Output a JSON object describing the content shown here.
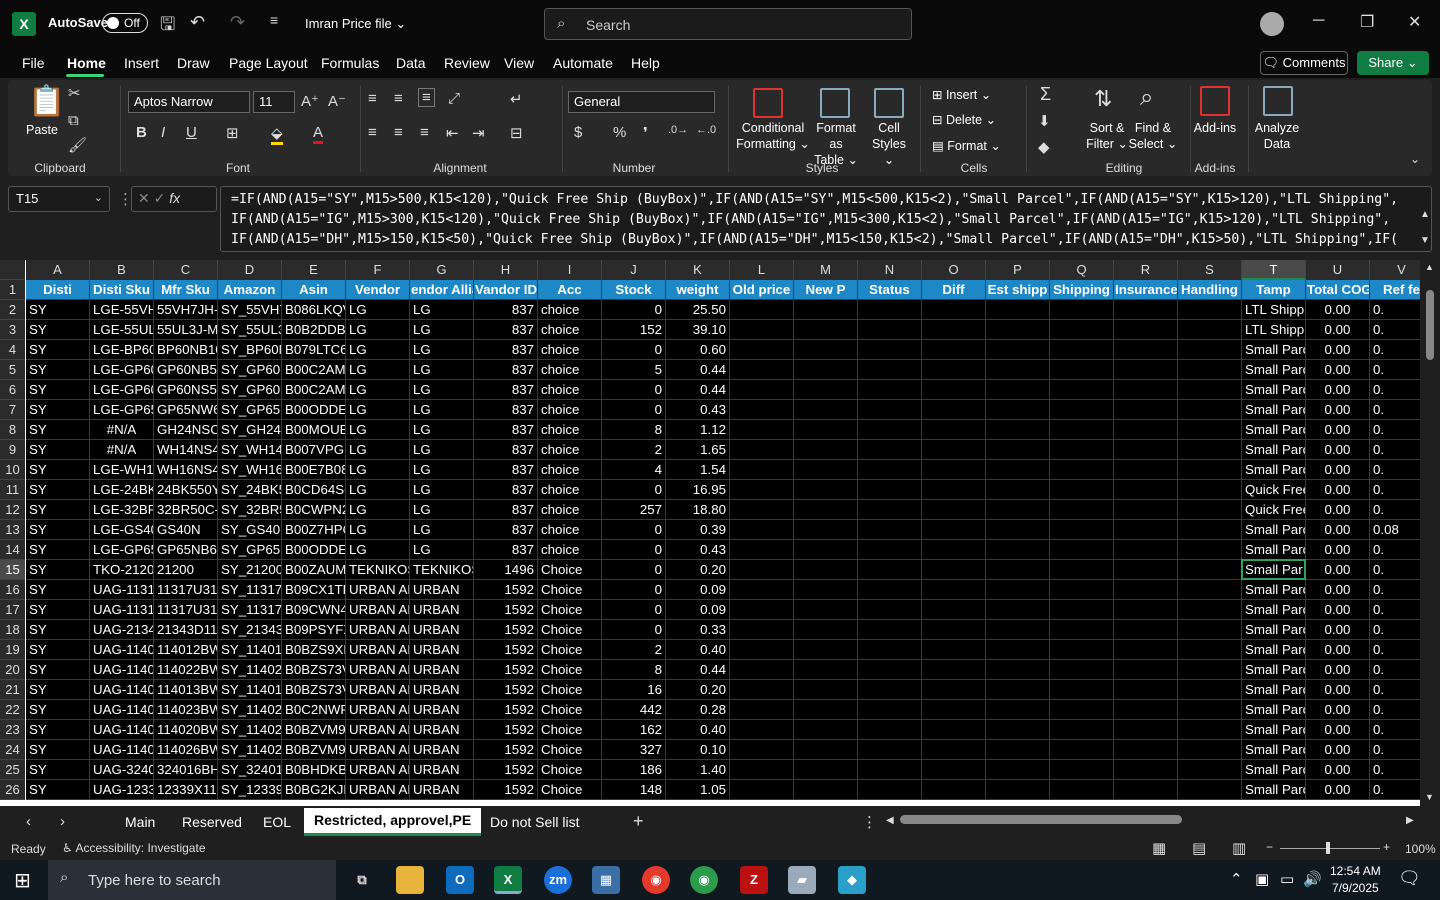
{
  "app": {
    "autosave_label": "AutoSave",
    "autosave_state": "Off",
    "filename": "Imran Price file",
    "search_placeholder": "Search"
  },
  "menu": {
    "items": [
      "File",
      "Home",
      "Insert",
      "Draw",
      "Page Layout",
      "Formulas",
      "Data",
      "Review",
      "View",
      "Automate",
      "Help"
    ],
    "active": "Home",
    "comments": "Comments",
    "share": "Share"
  },
  "ribbon": {
    "font_name": "Aptos Narrow",
    "font_size": "11",
    "number_format": "General",
    "paste": "Paste",
    "groups": [
      "Clipboard",
      "Font",
      "Alignment",
      "Number",
      "Styles",
      "Cells",
      "Editing",
      "Add-ins"
    ],
    "conditional_formatting": [
      "Conditional",
      "Formatting"
    ],
    "format_as_table": [
      "Format as",
      "Table"
    ],
    "cell_styles": [
      "Cell",
      "Styles"
    ],
    "insert": "Insert",
    "delete": "Delete",
    "format": "Format",
    "sort_filter": [
      "Sort &",
      "Filter"
    ],
    "find_select": [
      "Find &",
      "Select"
    ],
    "addins": "Add-ins",
    "analyze_data": [
      "Analyze",
      "Data"
    ]
  },
  "namebox": "T15",
  "formula_lines": [
    "=IF(AND(A15=\"SY\",M15>500,K15<120),\"Quick Free Ship (BuyBox)\",IF(AND(A15=\"SY\",M15<500,K15<2),\"Small Parcel\",IF(AND(A15=\"SY\",K15>120),\"LTL Shipping\",",
    "IF(AND(A15=\"IG\",M15>300,K15<120),\"Quick Free Ship (BuyBox)\",IF(AND(A15=\"IG\",M15<300,K15<2),\"Small Parcel\",IF(AND(A15=\"IG\",K15>120),\"LTL Shipping\",",
    "IF(AND(A15=\"DH\",M15>150,K15<50),\"Quick Free Ship (BuyBox)\",IF(AND(A15=\"DH\",M15<150,K15<2),\"Small Parcel\",IF(AND(A15=\"DH\",K15>50),\"LTL Shipping\",IF("
  ],
  "grid": {
    "columns": [
      "A",
      "B",
      "C",
      "D",
      "E",
      "F",
      "G",
      "H",
      "I",
      "J",
      "K",
      "L",
      "M",
      "N",
      "O",
      "P",
      "Q",
      "R",
      "S",
      "T",
      "U",
      "V"
    ],
    "headers": [
      "Disti",
      "Disti Sku",
      "Mfr Sku",
      "Amazon",
      "Asin",
      "Vendor",
      "endor Allia",
      "Vandor ID",
      "Acc",
      "Stock",
      "weight",
      "Old price",
      "New P",
      "Status",
      "Diff",
      "Est shipp",
      "Shipping",
      "Insurance",
      "Handling",
      "Tamp",
      "Total COG",
      "Ref fe"
    ],
    "selected_cell": "T15",
    "rows": [
      {
        "n": "2",
        "c": [
          "SY",
          "LGE-55VH7",
          "55VH7JH-4",
          "SY_55VH7J",
          "B086LKQV",
          "LG",
          "LG",
          "837",
          "choice",
          "0",
          "25.50",
          "",
          "",
          "",
          "",
          "",
          "",
          "",
          "",
          "LTL Shippi",
          "0.00",
          "0."
        ]
      },
      {
        "n": "3",
        "c": [
          "SY",
          "LGE-55UL3",
          "55UL3J-M",
          "SY_55UL3J",
          "B0B2DDBC",
          "LG",
          "LG",
          "837",
          "choice",
          "152",
          "39.10",
          "",
          "",
          "",
          "",
          "",
          "",
          "",
          "",
          "LTL Shippi",
          "0.00",
          "0."
        ]
      },
      {
        "n": "4",
        "c": [
          "SY",
          "LGE-BP60N",
          "BP60NB10",
          "SY_BP60N",
          "B079LTC6N",
          "LG",
          "LG",
          "837",
          "choice",
          "0",
          "0.60",
          "",
          "",
          "",
          "",
          "",
          "",
          "",
          "",
          "Small Parc",
          "0.00",
          "0."
        ]
      },
      {
        "n": "5",
        "c": [
          "SY",
          "LGE-GP60I",
          "GP60NB50",
          "SY_GP60N",
          "B00C2AMK",
          "LG",
          "LG",
          "837",
          "choice",
          "5",
          "0.44",
          "",
          "",
          "",
          "",
          "",
          "",
          "",
          "",
          "Small Parc",
          "0.00",
          "0."
        ]
      },
      {
        "n": "6",
        "c": [
          "SY",
          "LGE-GP60I",
          "GP60NS50",
          "SY_GP60N",
          "B00C2AMK",
          "LG",
          "LG",
          "837",
          "choice",
          "0",
          "0.44",
          "",
          "",
          "",
          "",
          "",
          "",
          "",
          "",
          "Small Parc",
          "0.00",
          "0."
        ]
      },
      {
        "n": "7",
        "c": [
          "SY",
          "LGE-GP65I",
          "GP65NW6",
          "SY_GP65N",
          "B00ODDEA",
          "LG",
          "LG",
          "837",
          "choice",
          "0",
          "0.43",
          "",
          "",
          "",
          "",
          "",
          "",
          "",
          "",
          "Small Parc",
          "0.00",
          "0."
        ]
      },
      {
        "n": "8",
        "c": [
          "SY",
          "#N/A",
          "GH24NSC0",
          "SY_GH24N",
          "B00MOUB",
          "LG",
          "LG",
          "837",
          "choice",
          "8",
          "1.12",
          "",
          "",
          "",
          "",
          "",
          "",
          "",
          "",
          "Small Parc",
          "0.00",
          "0."
        ]
      },
      {
        "n": "9",
        "c": [
          "SY",
          "#N/A",
          "WH14NS40",
          "SY_WH14N",
          "B007VPGL",
          "LG",
          "LG",
          "837",
          "choice",
          "2",
          "1.65",
          "",
          "",
          "",
          "",
          "",
          "",
          "",
          "",
          "Small Parc",
          "0.00",
          "0."
        ]
      },
      {
        "n": "10",
        "c": [
          "SY",
          "LGE-WH16",
          "WH16NS40",
          "SY_WH16N",
          "B00E7B08I",
          "LG",
          "LG",
          "837",
          "choice",
          "4",
          "1.54",
          "",
          "",
          "",
          "",
          "",
          "",
          "",
          "",
          "Small Parc",
          "0.00",
          "0."
        ]
      },
      {
        "n": "11",
        "c": [
          "SY",
          "LGE-24BK5",
          "24BK550Y-",
          "SY_24BK55",
          "B0CD64S6",
          "LG",
          "LG",
          "837",
          "choice",
          "0",
          "16.95",
          "",
          "",
          "",
          "",
          "",
          "",
          "",
          "",
          "Quick Free",
          "0.00",
          "0."
        ]
      },
      {
        "n": "12",
        "c": [
          "SY",
          "LGE-32BR5",
          "32BR50C-E",
          "SY_32BR50",
          "B0CWPN2",
          "LG",
          "LG",
          "837",
          "choice",
          "257",
          "18.80",
          "",
          "",
          "",
          "",
          "",
          "",
          "",
          "",
          "Quick Free",
          "0.00",
          "0."
        ]
      },
      {
        "n": "13",
        "c": [
          "SY",
          "LGE-GS40I",
          "GS40N",
          "SY_GS40N",
          "B00Z7HPQ",
          "LG",
          "LG",
          "837",
          "choice",
          "0",
          "0.39",
          "",
          "",
          "",
          "",
          "",
          "",
          "",
          "",
          "Small Parc",
          "0.00",
          "0.08"
        ]
      },
      {
        "n": "14",
        "c": [
          "SY",
          "LGE-GP65I",
          "GP65NB60",
          "SY_GP65N",
          "B00ODDE3",
          "LG",
          "LG",
          "837",
          "choice",
          "0",
          "0.43",
          "",
          "",
          "",
          "",
          "",
          "",
          "",
          "",
          "Small Parc",
          "0.00",
          "0."
        ]
      },
      {
        "n": "15",
        "c": [
          "SY",
          "TKO-21200",
          "21200",
          "SY_21200",
          "B00ZAUMI",
          "TEKNIKOS",
          "TEKNIKOS",
          "1496",
          "Choice",
          "0",
          "0.20",
          "",
          "",
          "",
          "",
          "",
          "",
          "",
          "",
          "Small Par",
          "0.00",
          "0."
        ]
      },
      {
        "n": "16",
        "c": [
          "SY",
          "UAG-11317",
          "11317U313",
          "SY_11317U",
          "B09CX1TK",
          "URBAN AR",
          "URBAN",
          "1592",
          "Choice",
          "0",
          "0.09",
          "",
          "",
          "",
          "",
          "",
          "",
          "",
          "",
          "Small Parc",
          "0.00",
          "0."
        ]
      },
      {
        "n": "17",
        "c": [
          "SY",
          "UAG-11317",
          "11317U317",
          "SY_11317U",
          "B09CWN4",
          "URBAN AR",
          "URBAN",
          "1592",
          "Choice",
          "0",
          "0.09",
          "",
          "",
          "",
          "",
          "",
          "",
          "",
          "",
          "Small Parc",
          "0.00",
          "0."
        ]
      },
      {
        "n": "18",
        "c": [
          "SY",
          "UAG-21343",
          "21343D114",
          "SY_21343D",
          "B09PSYFX",
          "URBAN AR",
          "URBAN",
          "1592",
          "Choice",
          "0",
          "0.33",
          "",
          "",
          "",
          "",
          "",
          "",
          "",
          "",
          "Small Parc",
          "0.00",
          "0."
        ]
      },
      {
        "n": "19",
        "c": [
          "SY",
          "UAG-11401",
          "114012BW",
          "SY_114012",
          "B0BZS9XR",
          "URBAN AR",
          "URBAN",
          "1592",
          "Choice",
          "2",
          "0.40",
          "",
          "",
          "",
          "",
          "",
          "",
          "",
          "",
          "Small Parc",
          "0.00",
          "0."
        ]
      },
      {
        "n": "20",
        "c": [
          "SY",
          "UAG-11402",
          "114022BW",
          "SY_114022",
          "B0BZS73V",
          "URBAN AR",
          "URBAN",
          "1592",
          "Choice",
          "8",
          "0.44",
          "",
          "",
          "",
          "",
          "",
          "",
          "",
          "",
          "Small Parc",
          "0.00",
          "0."
        ]
      },
      {
        "n": "21",
        "c": [
          "SY",
          "UAG-11401",
          "114013BW",
          "SY_114013",
          "B0BZS73V",
          "URBAN AR",
          "URBAN",
          "1592",
          "Choice",
          "16",
          "0.20",
          "",
          "",
          "",
          "",
          "",
          "",
          "",
          "",
          "Small Parc",
          "0.00",
          "0."
        ]
      },
      {
        "n": "22",
        "c": [
          "SY",
          "UAG-11402",
          "114023BW",
          "SY_114023",
          "B0C2NWP",
          "URBAN AR",
          "URBAN",
          "1592",
          "Choice",
          "442",
          "0.28",
          "",
          "",
          "",
          "",
          "",
          "",
          "",
          "",
          "Small Parc",
          "0.00",
          "0."
        ]
      },
      {
        "n": "23",
        "c": [
          "SY",
          "UAG-11402",
          "114020BW",
          "SY_114020",
          "B0BZVM92",
          "URBAN AR",
          "URBAN",
          "1592",
          "Choice",
          "162",
          "0.40",
          "",
          "",
          "",
          "",
          "",
          "",
          "",
          "",
          "Small Parc",
          "0.00",
          "0."
        ]
      },
      {
        "n": "24",
        "c": [
          "SY",
          "UAG-11402",
          "114026BW",
          "SY_114026",
          "B0BZVM92",
          "URBAN AR",
          "URBAN",
          "1592",
          "Choice",
          "327",
          "0.10",
          "",
          "",
          "",
          "",
          "",
          "",
          "",
          "",
          "Small Parc",
          "0.00",
          "0."
        ]
      },
      {
        "n": "25",
        "c": [
          "SY",
          "UAG-32401",
          "324016BH",
          "SY_324016",
          "B0BHDKB8",
          "URBAN AR",
          "URBAN",
          "1592",
          "Choice",
          "186",
          "1.40",
          "",
          "",
          "",
          "",
          "",
          "",
          "",
          "",
          "Small Parc",
          "0.00",
          "0."
        ]
      },
      {
        "n": "26",
        "c": [
          "SY",
          "UAG-12339",
          "12339X114",
          "SY_12339X",
          "B0BG2KJP",
          "URBAN AR",
          "URBAN",
          "1592",
          "Choice",
          "148",
          "1.05",
          "",
          "",
          "",
          "",
          "",
          "",
          "",
          "",
          "Small Parc",
          "0.00",
          "0."
        ]
      }
    ]
  },
  "sheets": [
    "Main",
    "Reserved",
    "EOL",
    "Restricted, approvel,PE",
    "Do not Sell list"
  ],
  "active_sheet": "Restricted, approvel,PE",
  "status": {
    "ready": "Ready",
    "accessibility": "Accessibility: Investigate",
    "zoom": "100%"
  },
  "taskbar": {
    "search_placeholder": "Type here to search",
    "time": "12:54 AM",
    "date": "7/9/2025"
  }
}
